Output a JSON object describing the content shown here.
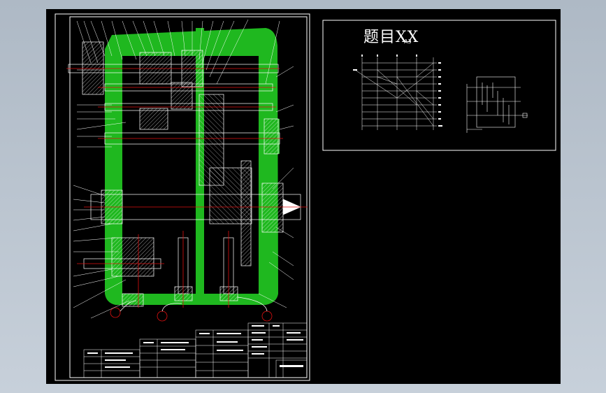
{
  "drawing": {
    "title": "题目XX",
    "sheet_size": "A3"
  },
  "colors": {
    "background": "#000000",
    "frame": "#ffffff",
    "housing": "#1fb81f",
    "centerline": "#e01010",
    "hatch": "#ffffff",
    "workspace": "#b9c4cf"
  }
}
